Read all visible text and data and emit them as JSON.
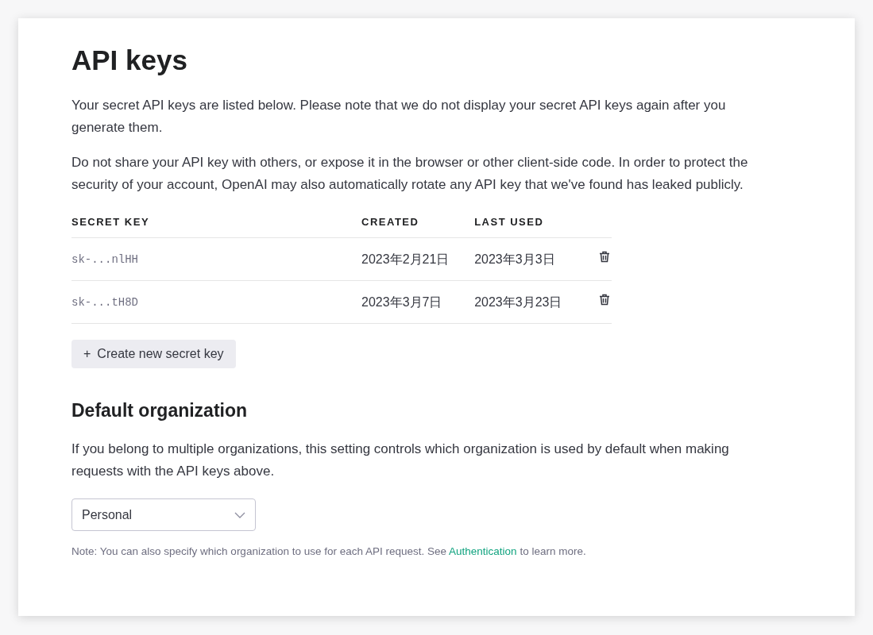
{
  "title": "API keys",
  "intro": [
    "Your secret API keys are listed below. Please note that we do not display your secret API keys again after you generate them.",
    "Do not share your API key with others, or expose it in the browser or other client-side code. In order to protect the security of your account, OpenAI may also automatically rotate any API key that we've found has leaked publicly."
  ],
  "table": {
    "columns": [
      "SECRET KEY",
      "CREATED",
      "LAST USED"
    ],
    "rows": [
      {
        "key": "sk-...nlHH",
        "created": "2023年2月21日",
        "last_used": "2023年3月3日"
      },
      {
        "key": "sk-...tH8D",
        "created": "2023年3月7日",
        "last_used": "2023年3月23日"
      }
    ]
  },
  "create_button": {
    "icon": "+",
    "label": "Create new secret key"
  },
  "org": {
    "heading": "Default organization",
    "description": "If you belong to multiple organizations, this setting controls which organization is used by default when making requests with the API keys above.",
    "select_value": "Personal"
  },
  "note": {
    "before": "Note: You can also specify which organization to use for each API request. See",
    "link": "Authentication",
    "after": "to learn more."
  }
}
